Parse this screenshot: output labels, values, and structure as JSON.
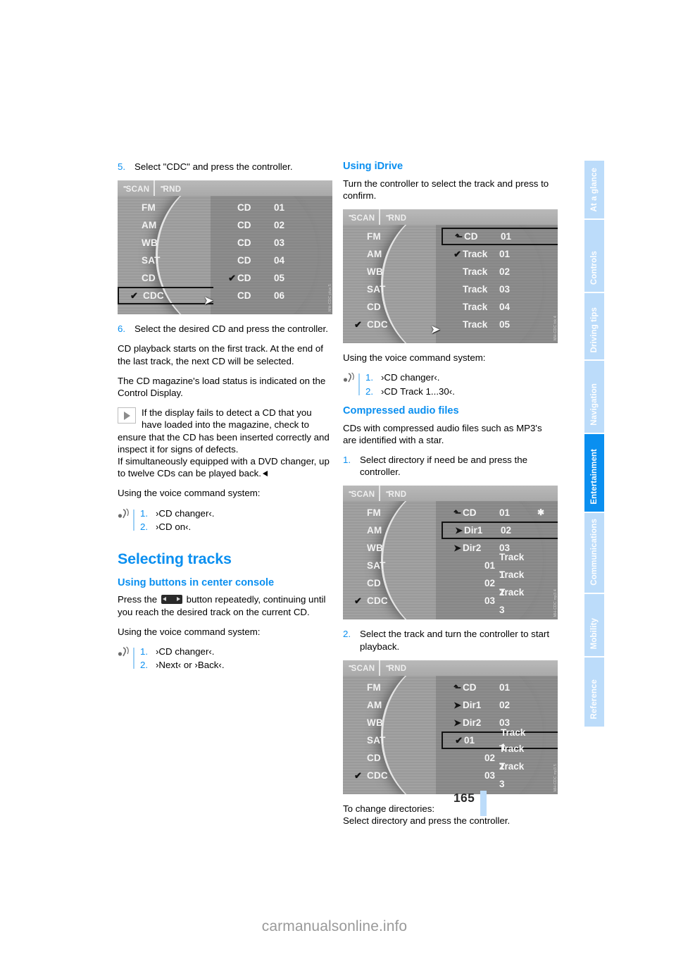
{
  "page": {
    "number": "165",
    "watermark": "carmanualsonline.info"
  },
  "sidebar": {
    "tabs": [
      {
        "label": "At a glance",
        "active": false
      },
      {
        "label": "Controls",
        "active": false
      },
      {
        "label": "Driving tips",
        "active": false
      },
      {
        "label": "Navigation",
        "active": false
      },
      {
        "label": "Entertainment",
        "active": true
      },
      {
        "label": "Communications",
        "active": false
      },
      {
        "label": "Mobility",
        "active": false
      },
      {
        "label": "Reference",
        "active": false
      }
    ],
    "accent_active": "#0a8ff0",
    "accent_inactive": "#bcdcfa"
  },
  "left_column": {
    "step5": {
      "num": "5.",
      "text": "Select \"CDC\" and press the controller."
    },
    "figure1": {
      "toolbar": [
        "SCAN",
        "RND"
      ],
      "left_items": [
        {
          "label": "FM",
          "checked": false,
          "selected": false
        },
        {
          "label": "AM",
          "checked": false,
          "selected": false
        },
        {
          "label": "WB",
          "checked": false,
          "selected": false
        },
        {
          "label": "SAT",
          "checked": false,
          "selected": false
        },
        {
          "label": "CD",
          "checked": false,
          "selected": false
        },
        {
          "label": "CDC",
          "checked": true,
          "selected": true
        }
      ],
      "right_items": [
        {
          "mark": "",
          "col1": "CD",
          "col2": "01"
        },
        {
          "mark": "",
          "col1": "CD",
          "col2": "02"
        },
        {
          "mark": "",
          "col1": "CD",
          "col2": "03"
        },
        {
          "mark": "",
          "col1": "CD",
          "col2": "04"
        },
        {
          "mark": "check",
          "col1": "CD",
          "col2": "05"
        },
        {
          "mark": "",
          "col1": "CD",
          "col2": "06"
        }
      ],
      "image_code": "MH-CDC plus 5"
    },
    "step6": {
      "num": "6.",
      "text": "Select the desired CD and press the controller."
    },
    "para1": "CD playback starts on the first track. At the end of the last track, the next CD will be selected.",
    "para2": "The CD magazine's load status is indicated on the Control Display.",
    "note": {
      "text_inline": "If the display fails to detect a CD that you have loaded into the magazine, check to",
      "text_cont": "ensure that the CD has been inserted correctly and inspect it for signs of defects.",
      "text_cont2": "If simultaneously equipped with a DVD changer, up to twelve CDs can be played back."
    },
    "voice_intro_1": "Using the voice command system:",
    "voice_1": [
      {
        "num": "1.",
        "text": "›CD changer‹."
      },
      {
        "num": "2.",
        "text": "›CD on‹."
      }
    ],
    "section_title": "Selecting tracks",
    "subsection_title": "Using buttons in center console",
    "button_para_before": "Press the",
    "button_para_after": "button repeatedly, continuing until you reach the desired track on the current CD.",
    "voice_intro_2": "Using the voice command system:",
    "voice_2": [
      {
        "num": "1.",
        "text": "›CD changer‹."
      },
      {
        "num": "2.",
        "text": "›Next‹ or ›Back‹."
      }
    ]
  },
  "right_column": {
    "idrive_title": "Using iDrive",
    "idrive_para": "Turn the controller to select the track and press to confirm.",
    "figure2": {
      "toolbar": [
        "SCAN",
        "RND"
      ],
      "left_items": [
        {
          "label": "FM",
          "checked": false,
          "selected": false
        },
        {
          "label": "AM",
          "checked": false,
          "selected": false
        },
        {
          "label": "WB",
          "checked": false,
          "selected": false
        },
        {
          "label": "SAT",
          "checked": false,
          "selected": false
        },
        {
          "label": "CD",
          "checked": false,
          "selected": false
        },
        {
          "label": "CDC",
          "checked": true,
          "selected": false
        }
      ],
      "right_items": [
        {
          "mark": "up",
          "col1": "CD",
          "col2": "01",
          "selected": true
        },
        {
          "mark": "check",
          "col1": "Track",
          "col2": "01",
          "selected": false
        },
        {
          "mark": "",
          "col1": "Track",
          "col2": "02",
          "selected": false
        },
        {
          "mark": "",
          "col1": "Track",
          "col2": "03",
          "selected": false
        },
        {
          "mark": "",
          "col1": "Track",
          "col2": "04",
          "selected": false
        },
        {
          "mark": "",
          "col1": "Track",
          "col2": "05",
          "selected": false
        }
      ],
      "image_code": "MH-CDC trk 4"
    },
    "voice_intro_3": "Using the voice command system:",
    "voice_3": [
      {
        "num": "1.",
        "text": "›CD changer‹."
      },
      {
        "num": "2.",
        "text": "›CD Track 1...30‹."
      }
    ],
    "compressed_title": "Compressed audio files",
    "compressed_para": "CDs with compressed audio files such as MP3's are identified with a star.",
    "step1": {
      "num": "1.",
      "text": "Select directory if need be and press the controller."
    },
    "figure3": {
      "toolbar": [
        "SCAN",
        "RND"
      ],
      "left_items": [
        {
          "label": "FM",
          "checked": false,
          "selected": false
        },
        {
          "label": "AM",
          "checked": false,
          "selected": false
        },
        {
          "label": "WB",
          "checked": false,
          "selected": false
        },
        {
          "label": "SAT",
          "checked": false,
          "selected": false
        },
        {
          "label": "CD",
          "checked": false,
          "selected": false
        },
        {
          "label": "CDC",
          "checked": true,
          "selected": false
        }
      ],
      "right_items": [
        {
          "mark": "up",
          "col1": "CD",
          "col2": "01",
          "star": true,
          "selected": false
        },
        {
          "mark": "arrow",
          "col1": "Dir1",
          "col2": "02",
          "selected": true
        },
        {
          "mark": "arrow",
          "col1": "Dir2",
          "col2": "03",
          "selected": false
        },
        {
          "mark": "",
          "col1": "01",
          "col2": "Track 1",
          "selected": false
        },
        {
          "mark": "",
          "col1": "02",
          "col2": "Track 2",
          "selected": false
        },
        {
          "mark": "",
          "col1": "03",
          "col2": "Track 3",
          "selected": false
        }
      ],
      "image_code": "MH-CDC mp3 4"
    },
    "step2": {
      "num": "2.",
      "text": "Select the track and turn the controller to start playback."
    },
    "figure4": {
      "toolbar": [
        "SCAN",
        "RND"
      ],
      "left_items": [
        {
          "label": "FM",
          "checked": false,
          "selected": false
        },
        {
          "label": "AM",
          "checked": false,
          "selected": false
        },
        {
          "label": "WB",
          "checked": false,
          "selected": false
        },
        {
          "label": "SAT",
          "checked": false,
          "selected": false
        },
        {
          "label": "CD",
          "checked": false,
          "selected": false
        },
        {
          "label": "CDC",
          "checked": true,
          "selected": false
        }
      ],
      "right_items": [
        {
          "mark": "up",
          "col1": "CD",
          "col2": "01",
          "selected": false
        },
        {
          "mark": "arrow",
          "col1": "Dir1",
          "col2": "02",
          "selected": false
        },
        {
          "mark": "arrow",
          "col1": "Dir2",
          "col2": "03",
          "selected": false
        },
        {
          "mark": "check",
          "col1": "01",
          "col2": "Track 1",
          "selected": true
        },
        {
          "mark": "",
          "col1": "02",
          "col2": "Track 2",
          "selected": false
        },
        {
          "mark": "",
          "col1": "03",
          "col2": "Track 3",
          "selected": false
        }
      ],
      "image_code": "MH-CDC mp3 5"
    },
    "closing_1": "To change directories:",
    "closing_2": "Select directory and press the controller."
  }
}
